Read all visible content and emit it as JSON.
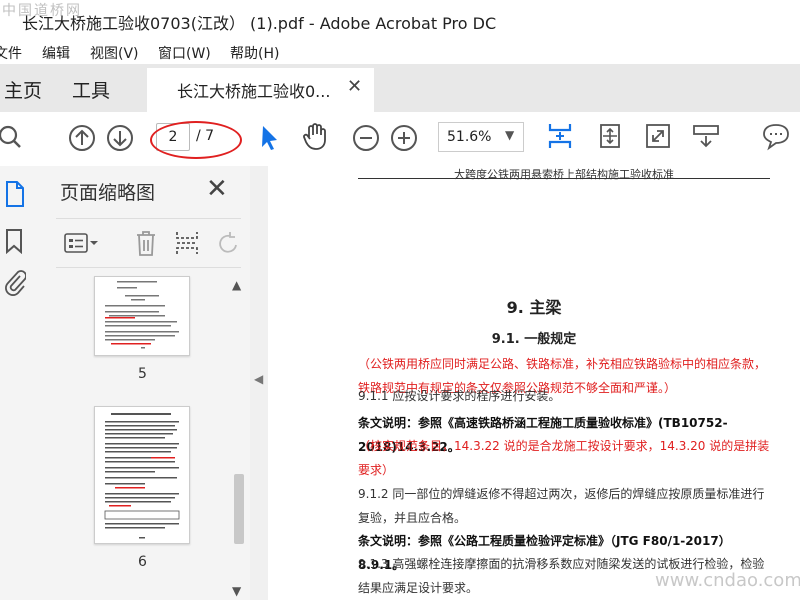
{
  "watermark_top": "中国道桥网",
  "watermark_bottom": "www.cndao.com",
  "window_title": "长江大桥施工验收0703(江改） (1).pdf - Adobe Acrobat Pro DC",
  "menu": [
    "文件",
    "编辑",
    "视图(V)",
    "窗口(W)",
    "帮助(H)"
  ],
  "tabs": {
    "home": "主页",
    "tools": "工具",
    "doc": "长江大桥施工验收0...",
    "doc_close": "✕"
  },
  "toolbar": {
    "current_page": "2",
    "total_pages": "/ 7",
    "zoom": "51.6%",
    "icons": [
      "search-icon",
      "page-up-icon",
      "page-down-icon",
      "select-cursor-icon",
      "hand-icon",
      "zoom-out-icon",
      "zoom-in-icon",
      "fit-page-icon",
      "rotate-page-icon",
      "fullscreen-icon",
      "scroll-mode-icon",
      "comment-icon"
    ]
  },
  "thumbnails_panel": {
    "title": "页面缩略图",
    "close": "✕",
    "pages": [
      {
        "label": "5"
      },
      {
        "label": "6"
      }
    ]
  },
  "document": {
    "running_header": "大跨度公铁两用悬索桥上部结构施工验收标准",
    "section_title": "9. 主梁",
    "subsection_title": "9.1. 一般规定",
    "paragraphs": [
      {
        "text": "（公铁两用桥应同时满足公路、铁路标准，补充相应铁路验标中的相应条款，铁路规范中有规定的条文仅参照公路规范不够全面和严谨。）",
        "style": "red"
      },
      {
        "text": "9.1.1  应按设计要求的程序进行安装。",
        "style": "normal"
      },
      {
        "text": "条文说明：参照《高速铁路桥涵工程施工质量验收标准》(TB10752-2018)14.3.22。",
        "style": "bold"
      },
      {
        "text": "（核实规范条目，14.3.22 说的是合龙施工按设计要求，14.3.20 说的是拼装要求）",
        "style": "red"
      },
      {
        "text": "9.1.2  同一部位的焊缝返修不得超过两次，返修后的焊缝应按原质量标准进行复验，并且应合格。",
        "style": "normal"
      },
      {
        "text": "条文说明：参照《公路工程质量检验评定标准》（JTG F80/1-2017）8.9.1。",
        "style": "bold"
      },
      {
        "text": "9.1.3  高强螺栓连接摩擦面的抗滑移系数应对随梁发送的试板进行检验，检验结果应满足设计要求。",
        "style": "normal"
      }
    ]
  },
  "colors": {
    "accent": "#1473e6",
    "annotation": "#e02020"
  }
}
